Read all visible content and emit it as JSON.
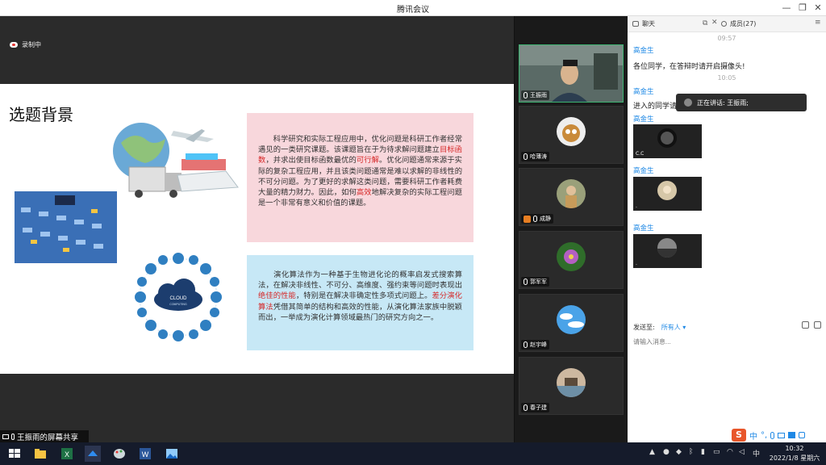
{
  "window": {
    "title": "腾讯会议"
  },
  "recording": {
    "label": "录制中"
  },
  "slide": {
    "title": "选题背景",
    "box1": {
      "p1": "科学研究和实际工程应用中，优化问题是科研工作者经常遇见的一类研究课题。该课题旨在于为待求解问题建立",
      "h1": "目标函数",
      "p2": "，并求出使目标函数最优的",
      "h2": "可行解",
      "p3": "。优化问题通常来源于实际的复杂工程应用，并且该类问题通常是难以求解的非线性的不可分问题。为了更好的求解这类问题，需要科研工作者耗费大量的精力财力。因此，如何",
      "h3": "高效",
      "p4": "地解决复杂的实际工程问题是一个非常有意义和价值的课题。"
    },
    "box2": {
      "p1": "演化算法作为一种基于生物进化论的概率启发式搜索算法，在解决非线性、不可分、高维度、强约束等问题时表现出",
      "h1": "绝佳的性能",
      "p2": "，特别是在解决非确定性多项式问题上。",
      "h2": "差分演化算法",
      "p3": "凭借其简单的结构和高效的性能，从演化算法家族中脱颖而出，一举成为演化计算领域最热门的研究方向之一。"
    },
    "cloud_label": "CLOUD",
    "cloud_sub": "COMPUTING"
  },
  "share_label": "王振雨的屏幕共享",
  "participants": [
    {
      "name": "王振雨"
    },
    {
      "name": "哈薄涛"
    },
    {
      "name": "成静"
    },
    {
      "name": "郭军军"
    },
    {
      "name": "赵宇峰"
    },
    {
      "name": "春子建"
    }
  ],
  "chat": {
    "tab_chat": "聊天",
    "tab_members": "成员(27)",
    "time1": "09:57",
    "time2": "10:05",
    "messages": [
      {
        "sender": "高金生",
        "text": "各位同学，在答辩时请开启摄像头!"
      },
      {
        "sender": "高金生",
        "text": "进入的同学请"
      }
    ],
    "thumb_senders": [
      "高金生",
      "高金生",
      "高金生"
    ],
    "thumb_names": [
      "C.C",
      ".",
      "."
    ],
    "speaking_toast": "正在讲话: 王振雨;",
    "send_to_label": "发送至:",
    "send_to_value": "所有人 ▾",
    "input_placeholder": "请输入消息..."
  },
  "taskbar": {
    "clock_time": "10:32",
    "clock_date": "2022/1/8 星期六",
    "ime": "中"
  },
  "colors": {
    "accent": "#1e88e5",
    "highlight": "#d62828",
    "pink": "#f8d7dc",
    "blue": "#c7e8f6"
  }
}
